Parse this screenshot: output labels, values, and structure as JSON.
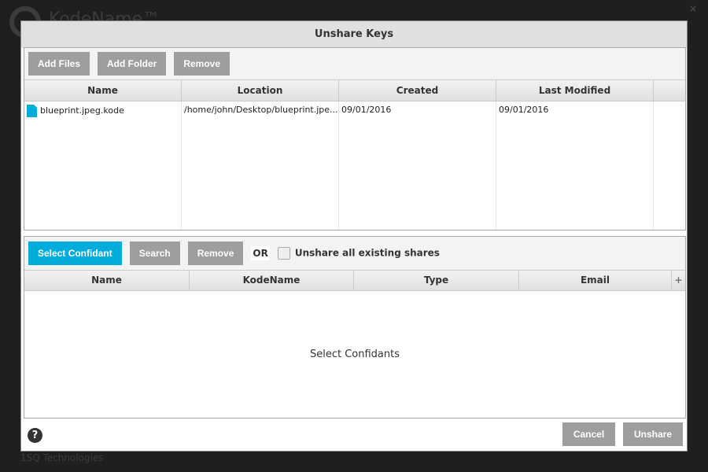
{
  "background": {
    "app_title": "KodeName™",
    "company": "1SQ Technologies"
  },
  "dialog": {
    "title": "Unshare Keys",
    "files_toolbar": {
      "add_files": "Add Files",
      "add_folder": "Add Folder",
      "remove": "Remove"
    },
    "files_table": {
      "columns": [
        "Name",
        "Location",
        "Created",
        "Last Modified"
      ],
      "rows": [
        {
          "name": "blueprint.jpeg.kode",
          "location": "/home/john/Desktop/blueprint.jpe...",
          "created": "09/01/2016",
          "modified": "09/01/2016"
        }
      ]
    },
    "confidant_toolbar": {
      "select": "Select Confidant",
      "search": "Search",
      "remove": "Remove",
      "or": "OR",
      "unshare_all": "Unshare all existing shares",
      "unshare_all_checked": false
    },
    "confidant_table": {
      "columns": [
        "Name",
        "KodeName",
        "Type",
        "Email"
      ],
      "add_column": "+",
      "empty": "Select Confidants"
    },
    "footer": {
      "help": "?",
      "cancel": "Cancel",
      "unshare": "Unshare"
    }
  },
  "colors": {
    "accent": "#00acd9",
    "button": "#9e9e9e"
  }
}
